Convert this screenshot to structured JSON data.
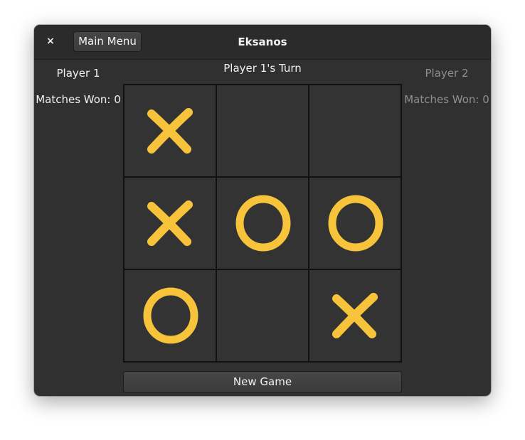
{
  "window": {
    "title": "Eksanos",
    "close_label": "×",
    "main_menu_label": "Main Menu"
  },
  "players": {
    "p1": {
      "name": "Player 1",
      "wins": "Matches Won: 0"
    },
    "p2": {
      "name": "Player 2",
      "wins": "Matches Won: 0"
    }
  },
  "status": {
    "turn": "Player 1's Turn"
  },
  "board": {
    "cells": [
      "X",
      "",
      "",
      "X",
      "O",
      "O",
      "O",
      "",
      "X"
    ]
  },
  "buttons": {
    "new_game": "New Game"
  },
  "colors": {
    "mark": "#f7c33b",
    "window_bg": "#303030",
    "cell_bg": "#333333",
    "grid_line": "#111111"
  }
}
